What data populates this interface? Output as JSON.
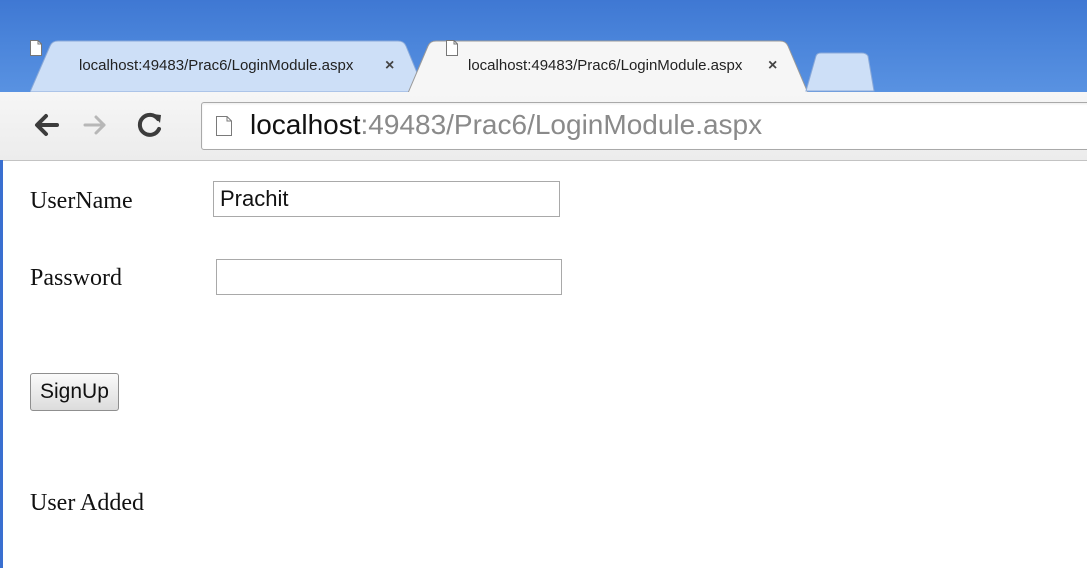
{
  "browser": {
    "tabs": [
      {
        "title": "localhost:49483/Prac6/LoginModule.aspx",
        "active": false,
        "close": "×"
      },
      {
        "title": "localhost:49483/Prac6/LoginModule.aspx",
        "active": true,
        "close": "×"
      }
    ],
    "address_bar": {
      "host": "localhost",
      "rest": ":49483/Prac6/LoginModule.aspx"
    }
  },
  "form": {
    "username_label": "UserName",
    "username_value": "Prachit",
    "password_label": "Password",
    "password_value": "",
    "signup_label": "SignUp",
    "status_message": "User Added"
  },
  "colors": {
    "chrome_blue": "#4a84da",
    "tab_inactive": "#cddff7",
    "tab_active": "#f6f6f6"
  }
}
